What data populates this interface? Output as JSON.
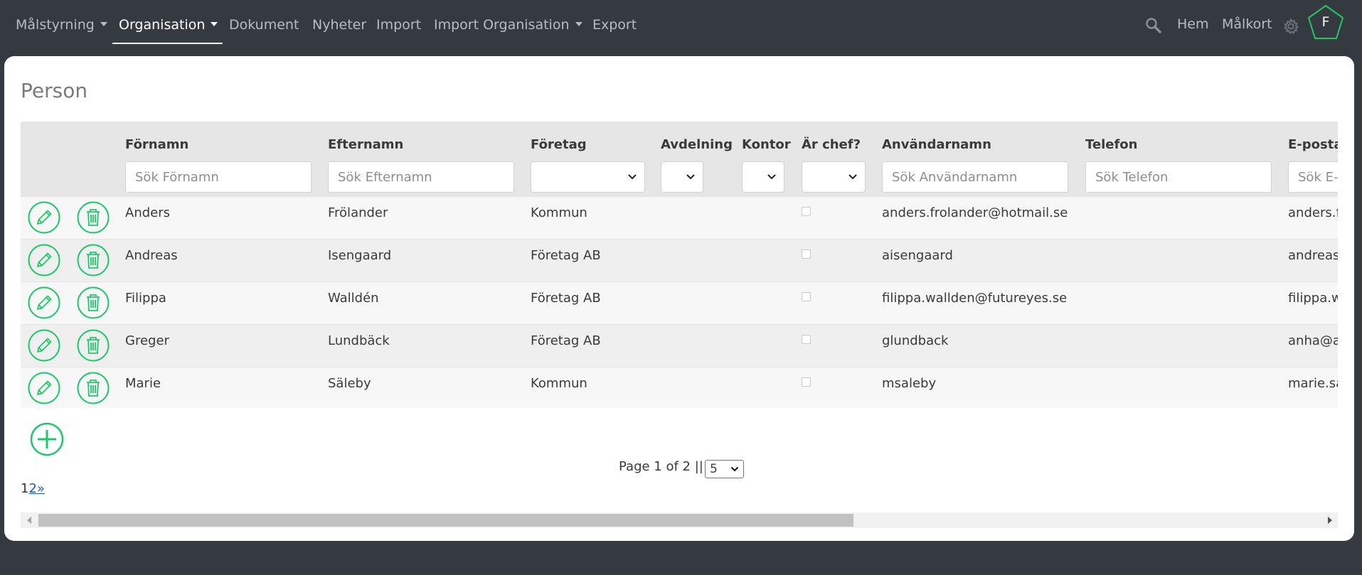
{
  "nav": {
    "items": [
      {
        "label": "Målstyrning",
        "dropdown": true
      },
      {
        "label": "Organisation",
        "dropdown": true,
        "active": true
      },
      {
        "label": "Dokument"
      },
      {
        "label": "Nyheter"
      },
      {
        "label": "Import"
      },
      {
        "label": "Import Organisation",
        "dropdown": true
      },
      {
        "label": "Export"
      }
    ],
    "right": {
      "search_icon": "search-icon",
      "home_label": "Hem",
      "scorecard_label": "Målkort",
      "settings_icon": "gear-icon",
      "avatar_initial": "F"
    }
  },
  "page": {
    "title": "Person"
  },
  "table": {
    "columns": [
      "Förnamn",
      "Efternamn",
      "Företag",
      "Avdelning",
      "Kontor",
      "Är chef?",
      "Användarnamn",
      "Telefon",
      "E-postad"
    ],
    "filters": {
      "firstname_placeholder": "Sök Förnamn",
      "lastname_placeholder": "Sök Efternamn",
      "username_placeholder": "Sök Användarnamn",
      "phone_placeholder": "Sök Telefon",
      "email_placeholder": "Sök E-"
    },
    "rows": [
      {
        "firstname": "Anders",
        "lastname": "Frölander",
        "company": "Kommun",
        "is_manager": false,
        "username": "anders.frolander@hotmail.se",
        "email": "anders.f"
      },
      {
        "firstname": "Andreas",
        "lastname": "Isengaard",
        "company": "Företag AB",
        "is_manager": false,
        "username": "aisengaard",
        "email": "andreas"
      },
      {
        "firstname": "Filippa",
        "lastname": "Walldén",
        "company": "Företag AB",
        "is_manager": false,
        "username": "filippa.wallden@futureyes.se",
        "email": "filippa.w"
      },
      {
        "firstname": "Greger",
        "lastname": "Lundbäck",
        "company": "Företag AB",
        "is_manager": false,
        "username": "glundback",
        "email": "anha@a"
      },
      {
        "firstname": "Marie",
        "lastname": "Säleby",
        "company": "Kommun",
        "is_manager": false,
        "username": "msaleby",
        "email": "marie.sa"
      }
    ]
  },
  "pagination": {
    "summary": "Page 1 of 2 ||",
    "page_size": "5",
    "current_page": "1",
    "next_page": "2",
    "next_arrow": "»"
  },
  "colors": {
    "accent": "#1ec96b",
    "navbar": "#343a40",
    "link": "#1a55d6"
  }
}
